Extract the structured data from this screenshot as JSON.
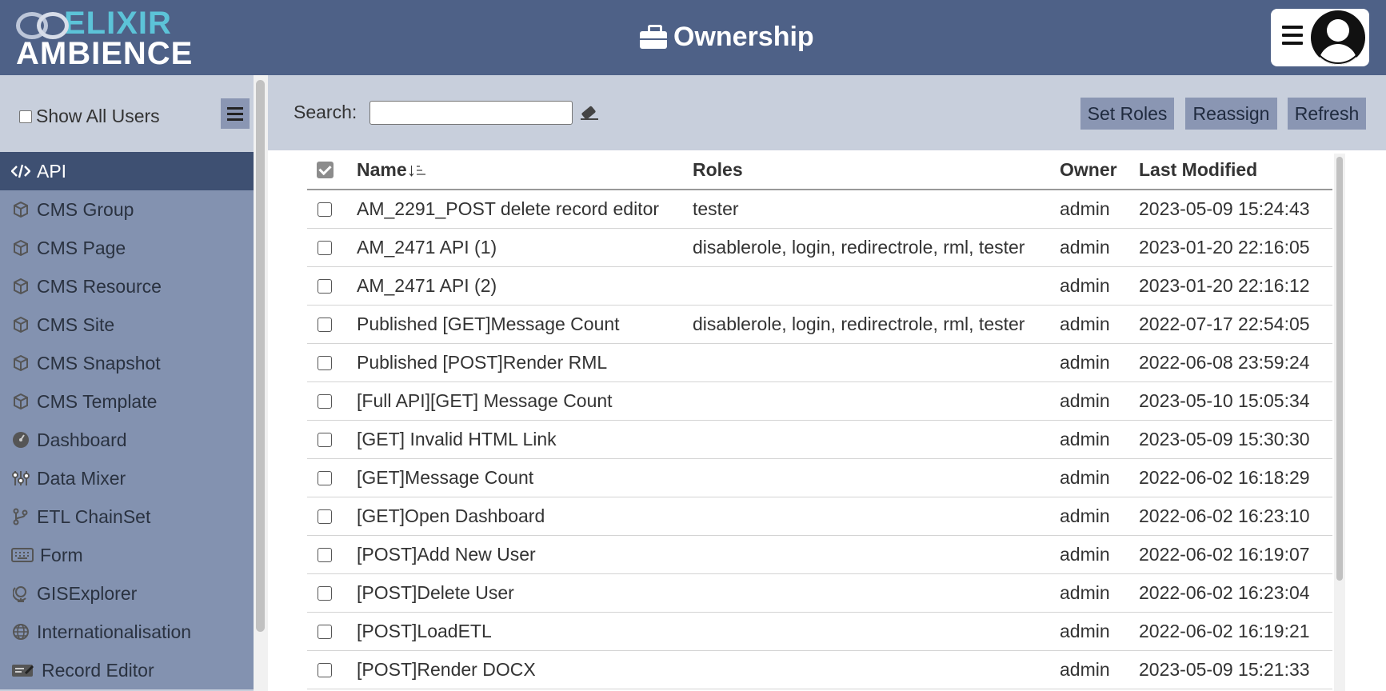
{
  "header": {
    "logo_top": "ELIXIR",
    "logo_bottom": "AMBIENCE",
    "title": "Ownership"
  },
  "sidebar": {
    "show_all_label": "Show All Users",
    "items": [
      {
        "label": "API",
        "icon": "code-icon",
        "active": true
      },
      {
        "label": "CMS Group",
        "icon": "cube-icon"
      },
      {
        "label": "CMS Page",
        "icon": "cube-icon"
      },
      {
        "label": "CMS Resource",
        "icon": "cube-icon"
      },
      {
        "label": "CMS Site",
        "icon": "cube-icon"
      },
      {
        "label": "CMS Snapshot",
        "icon": "cube-icon"
      },
      {
        "label": "CMS Template",
        "icon": "cube-icon"
      },
      {
        "label": "Dashboard",
        "icon": "dashboard-icon"
      },
      {
        "label": "Data Mixer",
        "icon": "sliders-icon"
      },
      {
        "label": "ETL ChainSet",
        "icon": "branch-icon"
      },
      {
        "label": "Form",
        "icon": "keyboard-icon"
      },
      {
        "label": "GISExplorer",
        "icon": "globe-stand-icon"
      },
      {
        "label": "Internationalisation",
        "icon": "globe-icon"
      },
      {
        "label": "Record Editor",
        "icon": "edit-card-icon"
      }
    ]
  },
  "toolbar": {
    "search_label": "Search:",
    "search_value": "",
    "set_roles": "Set Roles",
    "reassign": "Reassign",
    "refresh": "Refresh"
  },
  "table": {
    "columns": [
      "Name",
      "Roles",
      "Owner",
      "Last Modified"
    ],
    "sort_arrow": "↓",
    "rows": [
      {
        "name": "AM_2291_POST delete record editor",
        "roles": "tester",
        "owner": "admin",
        "modified": "2023-05-09 15:24:43"
      },
      {
        "name": "AM_2471 API (1)",
        "roles": "disablerole, login, redirectrole, rml, tester",
        "owner": "admin",
        "modified": "2023-01-20 22:16:05"
      },
      {
        "name": "AM_2471 API (2)",
        "roles": "",
        "owner": "admin",
        "modified": "2023-01-20 22:16:12"
      },
      {
        "name": "Published [GET]Message Count",
        "roles": "disablerole, login, redirectrole, rml, tester",
        "owner": "admin",
        "modified": "2022-07-17 22:54:05"
      },
      {
        "name": "Published [POST]Render RML",
        "roles": "",
        "owner": "admin",
        "modified": "2022-06-08 23:59:24"
      },
      {
        "name": "[Full API][GET] Message Count",
        "roles": "",
        "owner": "admin",
        "modified": "2023-05-10 15:05:34"
      },
      {
        "name": "[GET] Invalid HTML Link",
        "roles": "",
        "owner": "admin",
        "modified": "2023-05-09 15:30:30"
      },
      {
        "name": "[GET]Message Count",
        "roles": "",
        "owner": "admin",
        "modified": "2022-06-02 16:18:29"
      },
      {
        "name": "[GET]Open Dashboard",
        "roles": "",
        "owner": "admin",
        "modified": "2022-06-02 16:23:10"
      },
      {
        "name": "[POST]Add New User",
        "roles": "",
        "owner": "admin",
        "modified": "2022-06-02 16:19:07"
      },
      {
        "name": "[POST]Delete User",
        "roles": "",
        "owner": "admin",
        "modified": "2022-06-02 16:23:04"
      },
      {
        "name": "[POST]LoadETL",
        "roles": "",
        "owner": "admin",
        "modified": "2022-06-02 16:19:21"
      },
      {
        "name": "[POST]Render DOCX",
        "roles": "",
        "owner": "admin",
        "modified": "2023-05-09 15:21:33"
      }
    ]
  },
  "colors": {
    "header_bg": "#4e6187",
    "sidebar_item_bg": "#8392b0",
    "sidebar_active_bg": "#3e5072",
    "toolbar_bg": "#c8cfdc",
    "logo_accent": "#5cc3d8"
  }
}
